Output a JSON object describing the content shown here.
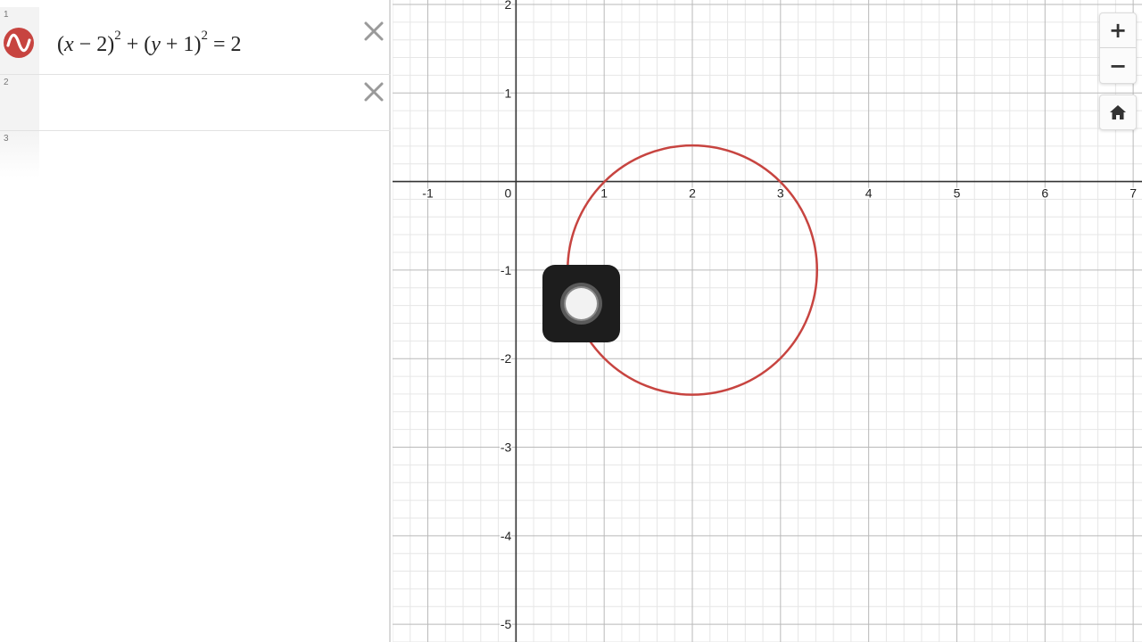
{
  "expressions": [
    {
      "number": "1",
      "icon": "desmos-graph-icon",
      "color": "#c74440",
      "latex_parts": {
        "open1": "(",
        "x": "x",
        "minus": " − 2",
        "close1": ")",
        "exp1": "2",
        "plus": " + (",
        "y": "y",
        "plus1": " + 1",
        "close2": ")",
        "exp2": "2",
        "equals": " = 2"
      }
    },
    {
      "number": "2"
    },
    {
      "number": "3"
    }
  ],
  "controls": {
    "zoom_in_icon": "plus-icon",
    "zoom_in_label": "+",
    "zoom_out_icon": "minus-icon",
    "zoom_out_label": "−",
    "home_icon": "home-icon"
  },
  "graph": {
    "x_ticks": [
      "-1",
      "0",
      "1",
      "2",
      "3",
      "4",
      "5",
      "6",
      "7"
    ],
    "y_ticks": [
      "2",
      "1",
      "-1",
      "-2",
      "-3",
      "-4",
      "-5"
    ],
    "x_range": [
      -1.4,
      7.1
    ],
    "y_range": [
      -5.2,
      2.05
    ],
    "curve": {
      "type": "circle",
      "center": [
        2,
        -1
      ],
      "radius_squared": 2,
      "color": "#c74440"
    }
  },
  "overlay": {
    "icon": "record-icon"
  }
}
